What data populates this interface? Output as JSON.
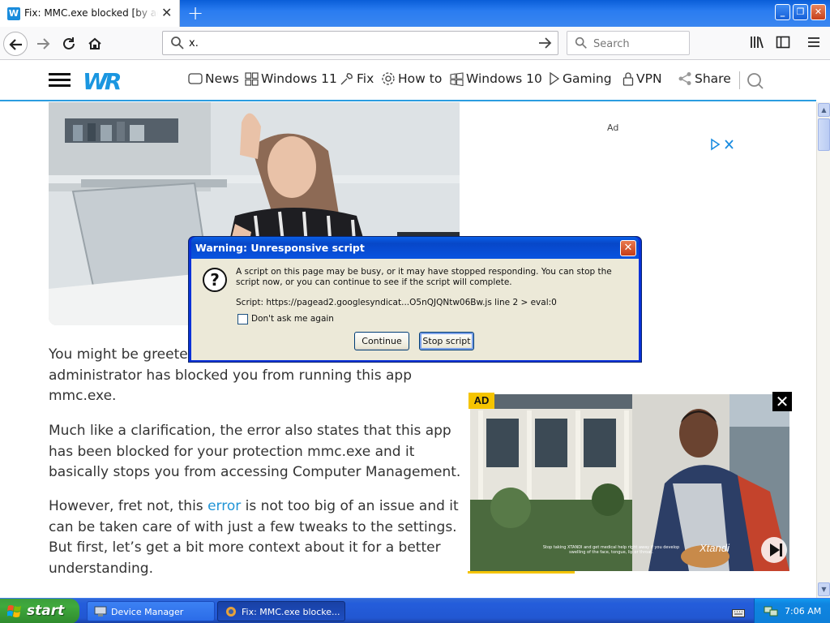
{
  "browser": {
    "tab_title": "Fix: MMC.exe blocked [by administrator]",
    "tab_favicon": "W",
    "url": "x.",
    "search_placeholder": "Search"
  },
  "site": {
    "logo": "WR",
    "menu": [
      {
        "label": "News",
        "icon": "news-icon"
      },
      {
        "label": "Windows 11",
        "icon": "windows-icon"
      },
      {
        "label": "Fix",
        "icon": "wrench-icon"
      },
      {
        "label": "How to",
        "icon": "gear-icon"
      },
      {
        "label": "Windows 10",
        "icon": "windows-icon"
      },
      {
        "label": "Gaming",
        "icon": "play-icon"
      },
      {
        "label": "VPN",
        "icon": "lock-icon"
      },
      {
        "label": "Share",
        "icon": "share-icon"
      }
    ]
  },
  "article": {
    "p1_a": "You might be greete",
    "p1_b": "administrator has blocked you from running this app",
    "p1_c": "mmc.exe.",
    "p2_a": "Much like a clarification, the error also states that this app",
    "p2_b": "has been blocked for your protection mmc.exe and it",
    "p2_c": "basically stops you from accessing Computer Management.",
    "p3_a_pre": "However, fret not, this ",
    "p3_a_link": "error",
    "p3_a_post": " is not too big of an issue and it",
    "p3_b": "can be taken care of with just a few tweaks to the settings.",
    "p3_c": "But first, let’s get a bit more context about it for a better",
    "p3_d": "understanding."
  },
  "ads": {
    "top_label": "Ad",
    "video_badge": "AD",
    "video_caption": "Stop taking XTANDI and get medical help right away if you develop swelling of the face, tongue, lip or throat.",
    "video_brand": "Xtandi"
  },
  "dialog": {
    "title": "Warning: Unresponsive script",
    "message": "A script on this page may be busy, or it may have stopped responding. You can stop the script now, or you can continue to see if the script will complete.",
    "script_line": "Script: https://pagead2.googlesyndicat...O5nQJQNtw06Bw.js line 2 > eval:0",
    "checkbox_label": "Don't ask me again",
    "continue_label": "Continue",
    "stop_label": "Stop script"
  },
  "taskbar": {
    "start_label": "start",
    "items": [
      {
        "label": "Device Manager"
      },
      {
        "label": "Fix: MMC.exe blocke..."
      }
    ],
    "clock": "7:06 AM"
  },
  "colors": {
    "accent": "#2b9de0",
    "link": "#2094d6",
    "xp_blue": "#245ddb",
    "xp_green": "#3fa93d",
    "ad_yellow": "#f5c400"
  }
}
